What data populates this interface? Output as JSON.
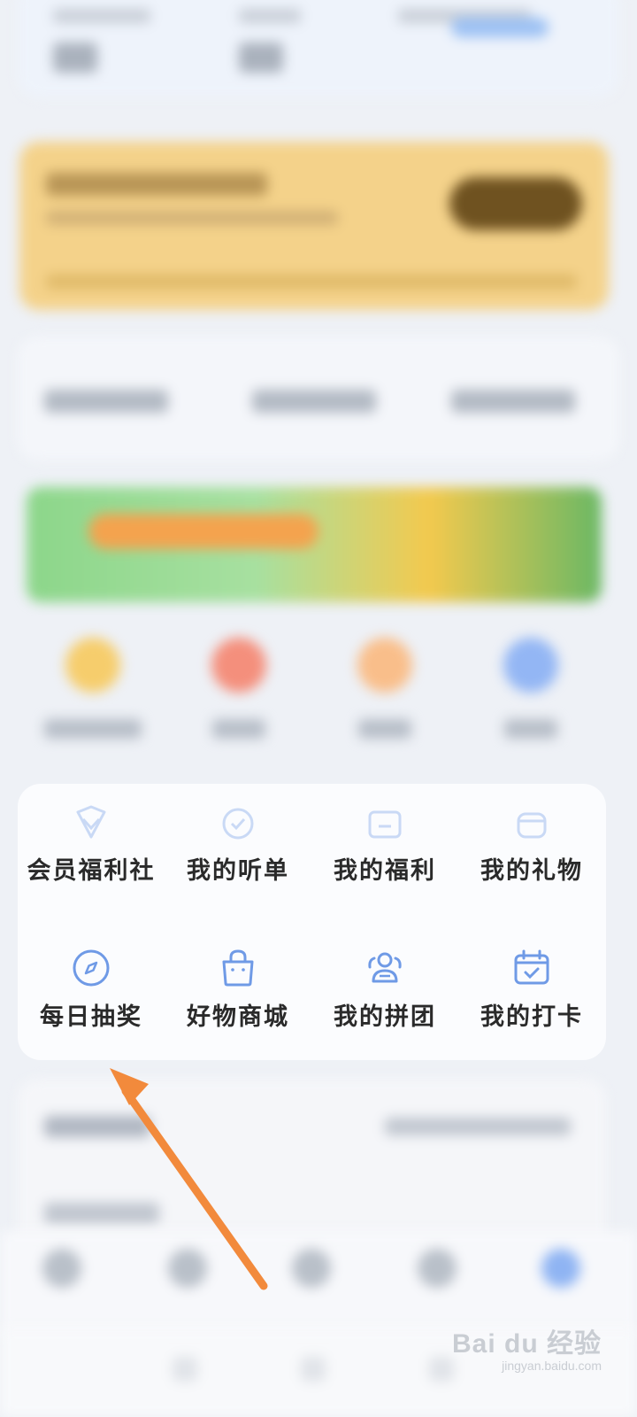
{
  "menu": {
    "row1": [
      {
        "label": "会员福利社",
        "icon": "diamond-shield-icon"
      },
      {
        "label": "我的听单",
        "icon": "circle-check-icon"
      },
      {
        "label": "我的福利",
        "icon": "gift-box-icon"
      },
      {
        "label": "我的礼物",
        "icon": "gift-bag-icon"
      }
    ],
    "row2": [
      {
        "label": "每日抽奖",
        "icon": "compass-icon"
      },
      {
        "label": "好物商城",
        "icon": "shopping-bag-icon"
      },
      {
        "label": "我的拼团",
        "icon": "group-icon"
      },
      {
        "label": "我的打卡",
        "icon": "calendar-check-icon"
      }
    ]
  },
  "watermark": {
    "brand": "Bai du 经验",
    "url": "jingyan.baidu.com"
  },
  "colors": {
    "icon_blue": "#6f9ae6",
    "arrow_orange": "#f28a3c",
    "label_text": "#2a2a2a"
  }
}
